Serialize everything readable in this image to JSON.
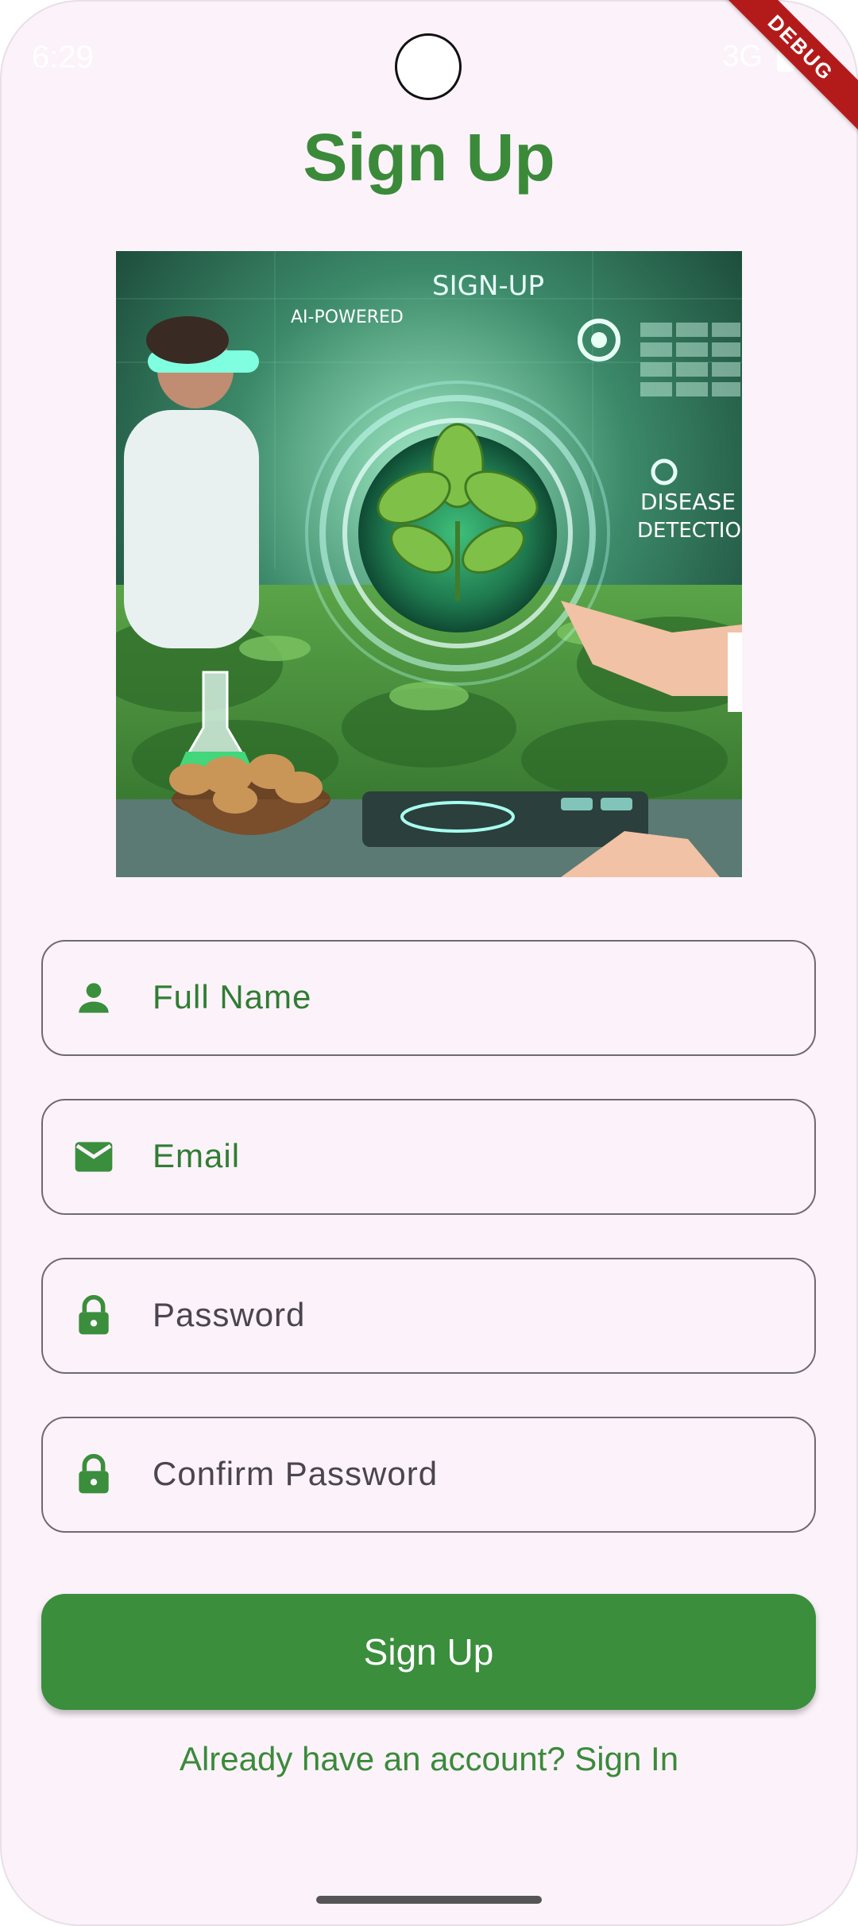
{
  "status_bar": {
    "time": "6:29",
    "network": "3G"
  },
  "debug_banner": "DEBUG",
  "title": "Sign Up",
  "hero_image": {
    "text_signup": "SIGN-UP",
    "text_ai": "AI-POWERED",
    "text_disease": "DISEASE",
    "text_detection": "DETECTION"
  },
  "form": {
    "full_name": {
      "placeholder": "Full Name",
      "icon": "person-icon"
    },
    "email": {
      "placeholder": "Email",
      "icon": "mail-icon"
    },
    "password": {
      "placeholder": "Password",
      "icon": "lock-icon"
    },
    "confirm_password": {
      "placeholder": "Confirm Password",
      "icon": "lock-icon"
    }
  },
  "signup_button": "Sign Up",
  "signin_link": "Already have an account? Sign In",
  "colors": {
    "primary": "#3a8e3c",
    "background": "#fcf2fa",
    "debug": "#b31b1b"
  }
}
